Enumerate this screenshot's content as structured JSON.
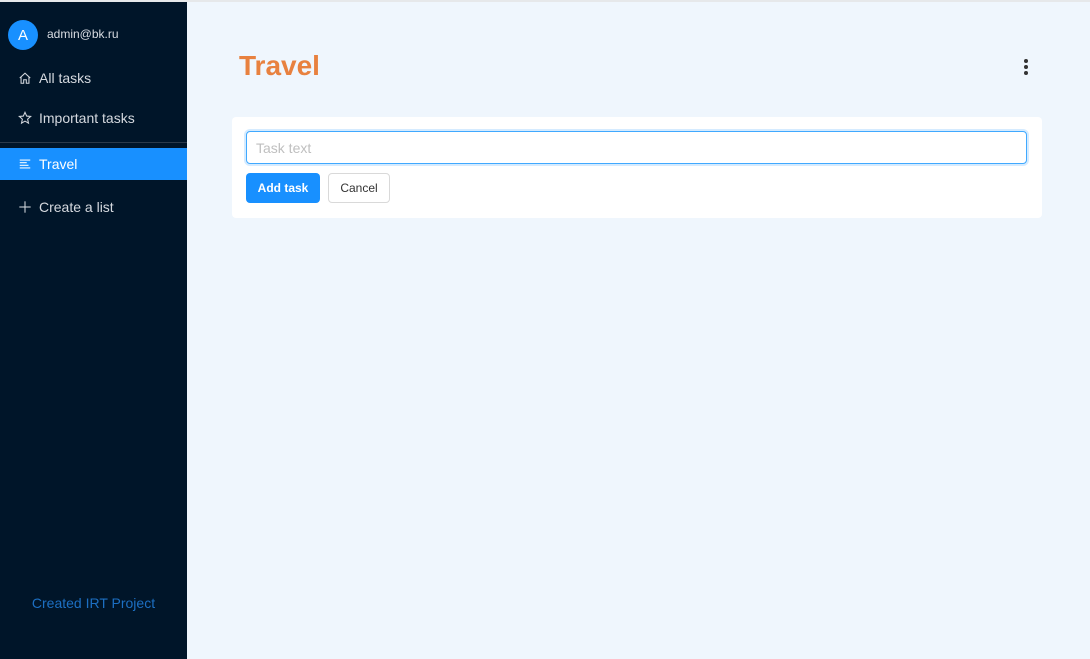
{
  "user": {
    "avatar_letter": "A",
    "email": "admin@bk.ru"
  },
  "sidebar": {
    "items": [
      {
        "label": "All tasks",
        "icon": "home-icon"
      },
      {
        "label": "Important tasks",
        "icon": "star-icon"
      },
      {
        "label": "Travel",
        "icon": "list-icon",
        "active": true
      },
      {
        "label": "Create a list",
        "icon": "plus-icon"
      }
    ],
    "footer": "Created IRT Project"
  },
  "main": {
    "title": "Travel",
    "form": {
      "input_placeholder": "Task text",
      "input_value": "",
      "add_label": "Add task",
      "cancel_label": "Cancel"
    }
  },
  "colors": {
    "sidebar_bg": "#001529",
    "accent": "#1890ff",
    "title": "#e8813f",
    "main_bg": "#eff6fd"
  }
}
